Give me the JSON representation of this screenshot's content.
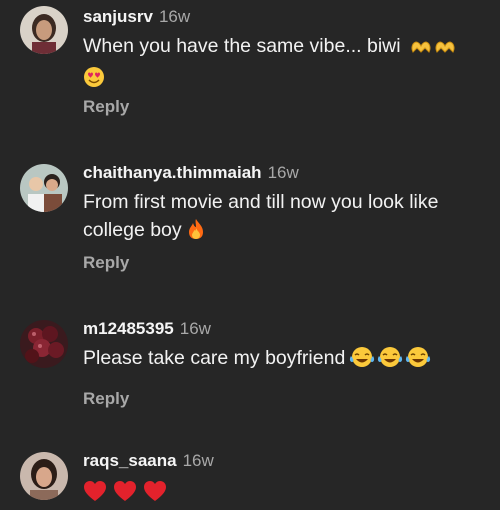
{
  "comments": [
    {
      "username": "sanjusrv",
      "time": "16w",
      "text": "When you have the same vibe... biwi",
      "emojis": [
        "heart-hands-emoji",
        "heart-hands-emoji",
        "smiling-heart-eyes-emoji"
      ],
      "reply_label": "Reply"
    },
    {
      "username": "chaithanya.thimmaiah",
      "time": "16w",
      "text": "From first movie and till now you look like college boy",
      "emojis": [
        "fire-emoji"
      ],
      "reply_label": "Reply"
    },
    {
      "username": "m12485395",
      "time": "16w",
      "text": "Please take care my boyfriend",
      "emojis": [
        "tears-of-joy-emoji",
        "tears-of-joy-emoji",
        "tears-of-joy-emoji"
      ],
      "reply_label": "Reply"
    },
    {
      "username": "raqs_saana",
      "time": "16w",
      "text": "",
      "emojis": [
        "red-heart-emoji",
        "red-heart-emoji",
        "red-heart-emoji"
      ],
      "reply_label": ""
    }
  ],
  "colors": {
    "background": "#262626",
    "username": "#f5f5f5",
    "secondary_text": "#a8a8a8"
  }
}
